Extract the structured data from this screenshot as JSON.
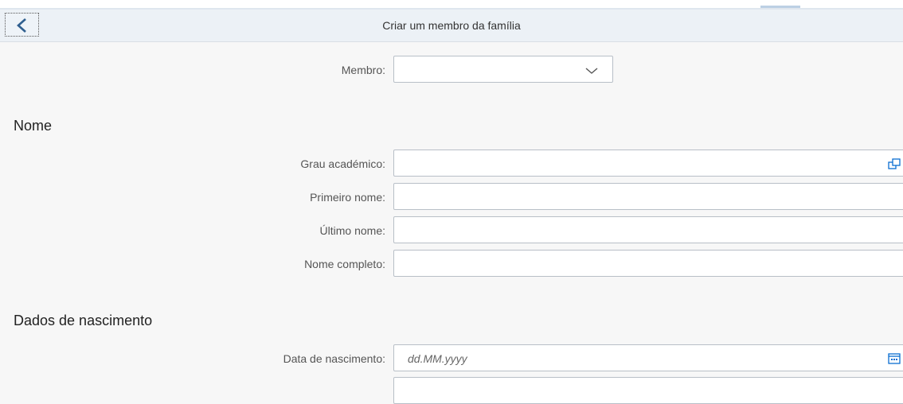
{
  "header": {
    "title": "Criar um membro da família"
  },
  "fields": {
    "membro": {
      "label": "Membro:",
      "value": ""
    },
    "grau": {
      "label": "Grau académico:",
      "value": ""
    },
    "primeiro": {
      "label": "Primeiro nome:",
      "value": ""
    },
    "ultimo": {
      "label": "Último nome:",
      "value": ""
    },
    "completo": {
      "label": "Nome completo:",
      "value": ""
    },
    "nascimento": {
      "label": "Data de nascimento:",
      "value": "",
      "placeholder": "dd.MM.yyyy"
    }
  },
  "sections": {
    "nome": "Nome",
    "nascimento": "Dados de nascimento"
  },
  "icons": {
    "back": "chevron-left-icon",
    "dropdown": "chevron-down-icon",
    "value_help": "value-help-icon",
    "calendar": "calendar-icon"
  },
  "colors": {
    "accent": "#0a6ed1",
    "header_bg": "#ecf1f6",
    "field_border": "#b8bfc7"
  }
}
